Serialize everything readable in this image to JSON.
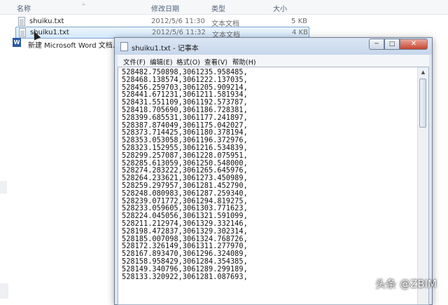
{
  "explorer": {
    "columns": {
      "name": "名称",
      "date": "修改日期",
      "type": "类型",
      "size": "大小"
    },
    "files": [
      {
        "name": "shuiku.txt",
        "date": "2012/5/6 11:30",
        "type": "文本文档",
        "size": "5 KB"
      },
      {
        "name": "shuiku1.txt",
        "date": "2012/5/6 11:32",
        "type": "文本文档",
        "size": "4 KB"
      }
    ],
    "word_file": "新建 Microsoft Word 文档.doc"
  },
  "notepad": {
    "title": "shuiku1.txt - 记事本",
    "menu": [
      "文件(F)",
      "编辑(E)",
      "格式(O)",
      "查看(V)",
      "帮助(H)"
    ],
    "lines": [
      "528482.750898,3061235.958485,",
      "528468.138574,3061222.137035,",
      "528456.259703,3061205.909214,",
      "528441.671231,3061211.581934,",
      "528431.551109,3061192.573787,",
      "528418.705690,3061186.728381,",
      "528399.685531,3061177.241897,",
      "528387.874049,3061175.042027,",
      "528373.714425,3061180.378194,",
      "528353.053058,3061196.372976,",
      "528323.152955,3061216.534839,",
      "528299.257087,3061228.075951,",
      "528285.613059,3061250.548000,",
      "528274.283222,3061265.645976,",
      "528264.233621,3061273.450989,",
      "528259.297957,3061281.452790,",
      "528248.080983,3061287.259340,",
      "528239.071772,3061294.819275,",
      "528233.059605,3061303.771623,",
      "528224.045056,3061321.591099,",
      "528211.212974,3061329.332146,",
      "528198.472837,3061329.302314,",
      "528185.007098,3061324.768726,",
      "528172.326149,3061311.277970,",
      "528167.893470,3061296.324089,",
      "528158.958429,3061284.354385,",
      "528149.340796,3061289.299189,",
      "528133.320922,3061281.087693,"
    ]
  },
  "watermark": "头条 @ZBIM"
}
